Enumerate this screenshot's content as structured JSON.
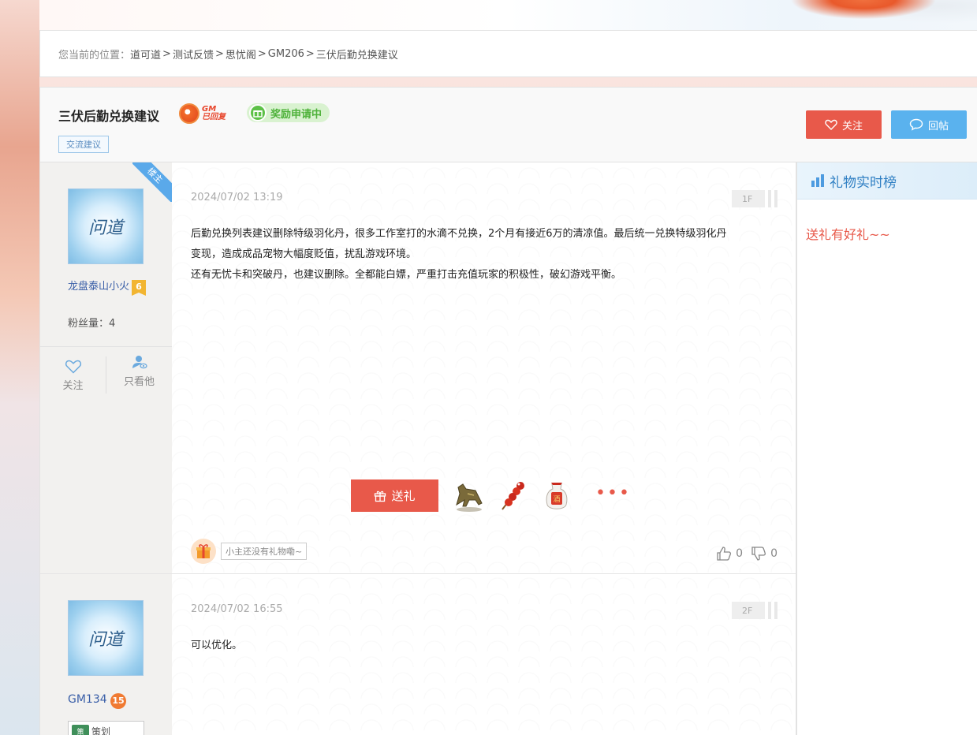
{
  "breadcrumb": {
    "prefix": "您当前的位置：",
    "items": [
      "道可道",
      "测试反馈",
      "思忧阁",
      "GM206",
      "三伏后勤兑换建议"
    ],
    "separator": ">"
  },
  "thread": {
    "title": "三伏后勤兑换建议",
    "gm_badge": "GM已回复",
    "gm_badge_top": "GM",
    "gm_badge_bottom": "已回复",
    "reward_badge": "奖励申请中",
    "tag": "交流建议",
    "follow_button": "关注",
    "reply_button": "回帖"
  },
  "posts": [
    {
      "ribbon": "楼主",
      "avatar_text": "问道",
      "username": "龙盘泰山小火",
      "level": "6",
      "fans": "粉丝量：4",
      "date": "2024/07/02 13:19",
      "floor": "1F",
      "content": [
        "后勤兑换列表建议删除特级羽化丹，很多工作室打的水滴不兑换，2个月有接近6万的清凉值。最后统一兑换特级羽化丹",
        "变现，造成成品宠物大幅度贬值，扰乱游戏环境。",
        "还有无忧卡和突破丹，也建议删除。全都能白嫖，严重打击充值玩家的积极性，破幻游戏平衡。"
      ],
      "actions": {
        "follow": "关注",
        "only_him": "只看他"
      },
      "gift_button": "送礼",
      "gift_items": [
        "bronze-horse",
        "candied-haws",
        "wine-jar"
      ],
      "more": "•••",
      "gift_empty_tip": "小主还没有礼物嘞~",
      "likes": "0",
      "dislikes": "0"
    },
    {
      "avatar_text": "问道",
      "username": "GM134",
      "level": "15",
      "role": "策划",
      "role_icon": "策",
      "date": "2024/07/02 16:55",
      "floor": "2F",
      "content": [
        "可以优化。"
      ]
    }
  ],
  "sidebar": {
    "title": "礼物实时榜",
    "message": "送礼有好礼~~"
  },
  "colors": {
    "accent_red": "#e8594a",
    "accent_blue": "#5ab2ee",
    "link_blue": "#3a5fa8"
  }
}
